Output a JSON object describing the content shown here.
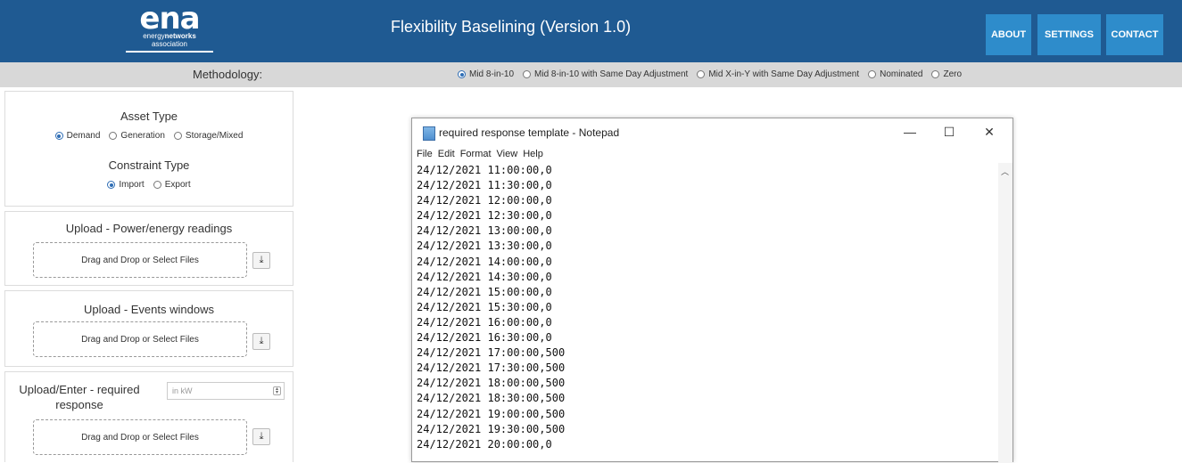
{
  "header": {
    "logo": {
      "word": "ena",
      "line1_a": "energy",
      "line1_b": "networks",
      "line2": "association"
    },
    "title": "Flexibility Baselining (Version 1.0)",
    "nav": {
      "about": "ABOUT",
      "settings": "SETTINGS",
      "contact": "CONTACT"
    },
    "colors": {
      "header_bg": "#1f5a92",
      "button_bg": "#2e8ccb"
    }
  },
  "methodology": {
    "label": "Methodology:",
    "options": [
      {
        "label": "Mid 8-in-10",
        "selected": true
      },
      {
        "label": "Mid 8-in-10 with Same Day Adjustment",
        "selected": false
      },
      {
        "label": "Mid X-in-Y with Same Day Adjustment",
        "selected": false
      },
      {
        "label": "Nominated",
        "selected": false
      },
      {
        "label": "Zero",
        "selected": false
      }
    ]
  },
  "asset_panel": {
    "asset_type_title": "Asset Type",
    "asset_options": [
      {
        "label": "Demand",
        "selected": true
      },
      {
        "label": "Generation",
        "selected": false
      },
      {
        "label": "Storage/Mixed",
        "selected": false
      }
    ],
    "constraint_type_title": "Constraint Type",
    "constraint_options": [
      {
        "label": "Import",
        "selected": true
      },
      {
        "label": "Export",
        "selected": false
      }
    ]
  },
  "upload_readings": {
    "title": "Upload - Power/energy readings",
    "drop_text": "Drag and Drop or Select Files",
    "download_icon": "download-icon"
  },
  "upload_events": {
    "title": "Upload - Events windows",
    "drop_text": "Drag and Drop or Select Files",
    "download_icon": "download-icon"
  },
  "upload_response": {
    "title_line1": "Upload/Enter - required",
    "title_line2": "response",
    "input_placeholder": "in kW",
    "drop_text": "Drag and Drop or Select Files",
    "download_icon": "download-icon"
  },
  "notepad": {
    "title": "required response template - Notepad",
    "controls": {
      "minimize": "—",
      "maximize": "☐",
      "close": "✕"
    },
    "menu": [
      "File",
      "Edit",
      "Format",
      "View",
      "Help"
    ],
    "lines": [
      "24/12/2021 11:00:00,0",
      "24/12/2021 11:30:00,0",
      "24/12/2021 12:00:00,0",
      "24/12/2021 12:30:00,0",
      "24/12/2021 13:00:00,0",
      "24/12/2021 13:30:00,0",
      "24/12/2021 14:00:00,0",
      "24/12/2021 14:30:00,0",
      "24/12/2021 15:00:00,0",
      "24/12/2021 15:30:00,0",
      "24/12/2021 16:00:00,0",
      "24/12/2021 16:30:00,0",
      "24/12/2021 17:00:00,500",
      "24/12/2021 17:30:00,500",
      "24/12/2021 18:00:00,500",
      "24/12/2021 18:30:00,500",
      "24/12/2021 19:00:00,500",
      "24/12/2021 19:30:00,500",
      "24/12/2021 20:00:00,0"
    ]
  }
}
